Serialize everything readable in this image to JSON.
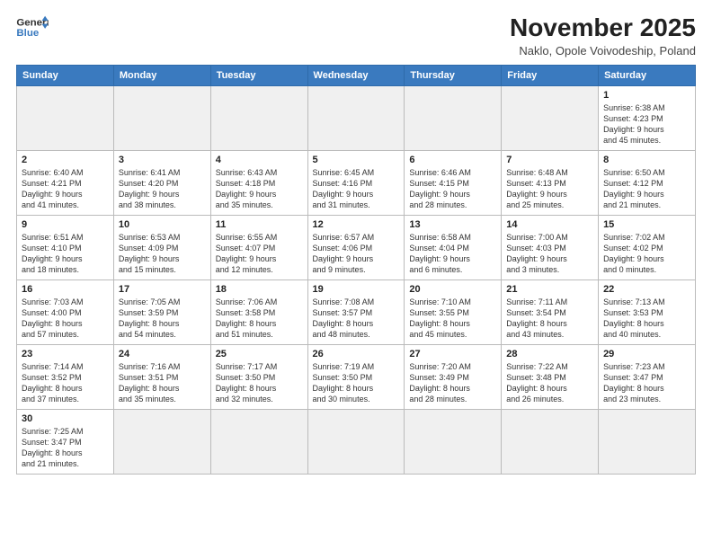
{
  "header": {
    "logo_line1": "General",
    "logo_line2": "Blue",
    "month_title": "November 2025",
    "subtitle": "Naklo, Opole Voivodeship, Poland"
  },
  "weekdays": [
    "Sunday",
    "Monday",
    "Tuesday",
    "Wednesday",
    "Thursday",
    "Friday",
    "Saturday"
  ],
  "weeks": [
    [
      {
        "day": "",
        "info": ""
      },
      {
        "day": "",
        "info": ""
      },
      {
        "day": "",
        "info": ""
      },
      {
        "day": "",
        "info": ""
      },
      {
        "day": "",
        "info": ""
      },
      {
        "day": "",
        "info": ""
      },
      {
        "day": "1",
        "info": "Sunrise: 6:38 AM\nSunset: 4:23 PM\nDaylight: 9 hours\nand 45 minutes."
      }
    ],
    [
      {
        "day": "2",
        "info": "Sunrise: 6:40 AM\nSunset: 4:21 PM\nDaylight: 9 hours\nand 41 minutes."
      },
      {
        "day": "3",
        "info": "Sunrise: 6:41 AM\nSunset: 4:20 PM\nDaylight: 9 hours\nand 38 minutes."
      },
      {
        "day": "4",
        "info": "Sunrise: 6:43 AM\nSunset: 4:18 PM\nDaylight: 9 hours\nand 35 minutes."
      },
      {
        "day": "5",
        "info": "Sunrise: 6:45 AM\nSunset: 4:16 PM\nDaylight: 9 hours\nand 31 minutes."
      },
      {
        "day": "6",
        "info": "Sunrise: 6:46 AM\nSunset: 4:15 PM\nDaylight: 9 hours\nand 28 minutes."
      },
      {
        "day": "7",
        "info": "Sunrise: 6:48 AM\nSunset: 4:13 PM\nDaylight: 9 hours\nand 25 minutes."
      },
      {
        "day": "8",
        "info": "Sunrise: 6:50 AM\nSunset: 4:12 PM\nDaylight: 9 hours\nand 21 minutes."
      }
    ],
    [
      {
        "day": "9",
        "info": "Sunrise: 6:51 AM\nSunset: 4:10 PM\nDaylight: 9 hours\nand 18 minutes."
      },
      {
        "day": "10",
        "info": "Sunrise: 6:53 AM\nSunset: 4:09 PM\nDaylight: 9 hours\nand 15 minutes."
      },
      {
        "day": "11",
        "info": "Sunrise: 6:55 AM\nSunset: 4:07 PM\nDaylight: 9 hours\nand 12 minutes."
      },
      {
        "day": "12",
        "info": "Sunrise: 6:57 AM\nSunset: 4:06 PM\nDaylight: 9 hours\nand 9 minutes."
      },
      {
        "day": "13",
        "info": "Sunrise: 6:58 AM\nSunset: 4:04 PM\nDaylight: 9 hours\nand 6 minutes."
      },
      {
        "day": "14",
        "info": "Sunrise: 7:00 AM\nSunset: 4:03 PM\nDaylight: 9 hours\nand 3 minutes."
      },
      {
        "day": "15",
        "info": "Sunrise: 7:02 AM\nSunset: 4:02 PM\nDaylight: 9 hours\nand 0 minutes."
      }
    ],
    [
      {
        "day": "16",
        "info": "Sunrise: 7:03 AM\nSunset: 4:00 PM\nDaylight: 8 hours\nand 57 minutes."
      },
      {
        "day": "17",
        "info": "Sunrise: 7:05 AM\nSunset: 3:59 PM\nDaylight: 8 hours\nand 54 minutes."
      },
      {
        "day": "18",
        "info": "Sunrise: 7:06 AM\nSunset: 3:58 PM\nDaylight: 8 hours\nand 51 minutes."
      },
      {
        "day": "19",
        "info": "Sunrise: 7:08 AM\nSunset: 3:57 PM\nDaylight: 8 hours\nand 48 minutes."
      },
      {
        "day": "20",
        "info": "Sunrise: 7:10 AM\nSunset: 3:55 PM\nDaylight: 8 hours\nand 45 minutes."
      },
      {
        "day": "21",
        "info": "Sunrise: 7:11 AM\nSunset: 3:54 PM\nDaylight: 8 hours\nand 43 minutes."
      },
      {
        "day": "22",
        "info": "Sunrise: 7:13 AM\nSunset: 3:53 PM\nDaylight: 8 hours\nand 40 minutes."
      }
    ],
    [
      {
        "day": "23",
        "info": "Sunrise: 7:14 AM\nSunset: 3:52 PM\nDaylight: 8 hours\nand 37 minutes."
      },
      {
        "day": "24",
        "info": "Sunrise: 7:16 AM\nSunset: 3:51 PM\nDaylight: 8 hours\nand 35 minutes."
      },
      {
        "day": "25",
        "info": "Sunrise: 7:17 AM\nSunset: 3:50 PM\nDaylight: 8 hours\nand 32 minutes."
      },
      {
        "day": "26",
        "info": "Sunrise: 7:19 AM\nSunset: 3:50 PM\nDaylight: 8 hours\nand 30 minutes."
      },
      {
        "day": "27",
        "info": "Sunrise: 7:20 AM\nSunset: 3:49 PM\nDaylight: 8 hours\nand 28 minutes."
      },
      {
        "day": "28",
        "info": "Sunrise: 7:22 AM\nSunset: 3:48 PM\nDaylight: 8 hours\nand 26 minutes."
      },
      {
        "day": "29",
        "info": "Sunrise: 7:23 AM\nSunset: 3:47 PM\nDaylight: 8 hours\nand 23 minutes."
      }
    ],
    [
      {
        "day": "30",
        "info": "Sunrise: 7:25 AM\nSunset: 3:47 PM\nDaylight: 8 hours\nand 21 minutes."
      },
      {
        "day": "",
        "info": ""
      },
      {
        "day": "",
        "info": ""
      },
      {
        "day": "",
        "info": ""
      },
      {
        "day": "",
        "info": ""
      },
      {
        "day": "",
        "info": ""
      },
      {
        "day": "",
        "info": ""
      }
    ]
  ]
}
